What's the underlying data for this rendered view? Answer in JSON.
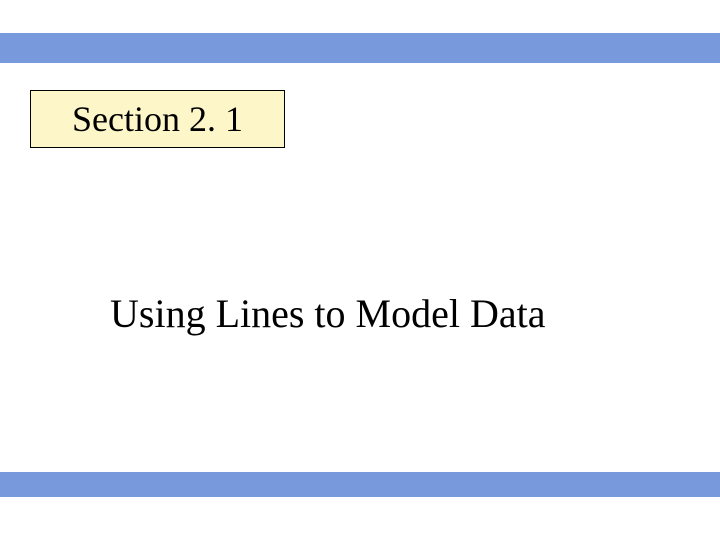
{
  "section": {
    "label": "Section 2. 1"
  },
  "title": "Using Lines to Model Data"
}
